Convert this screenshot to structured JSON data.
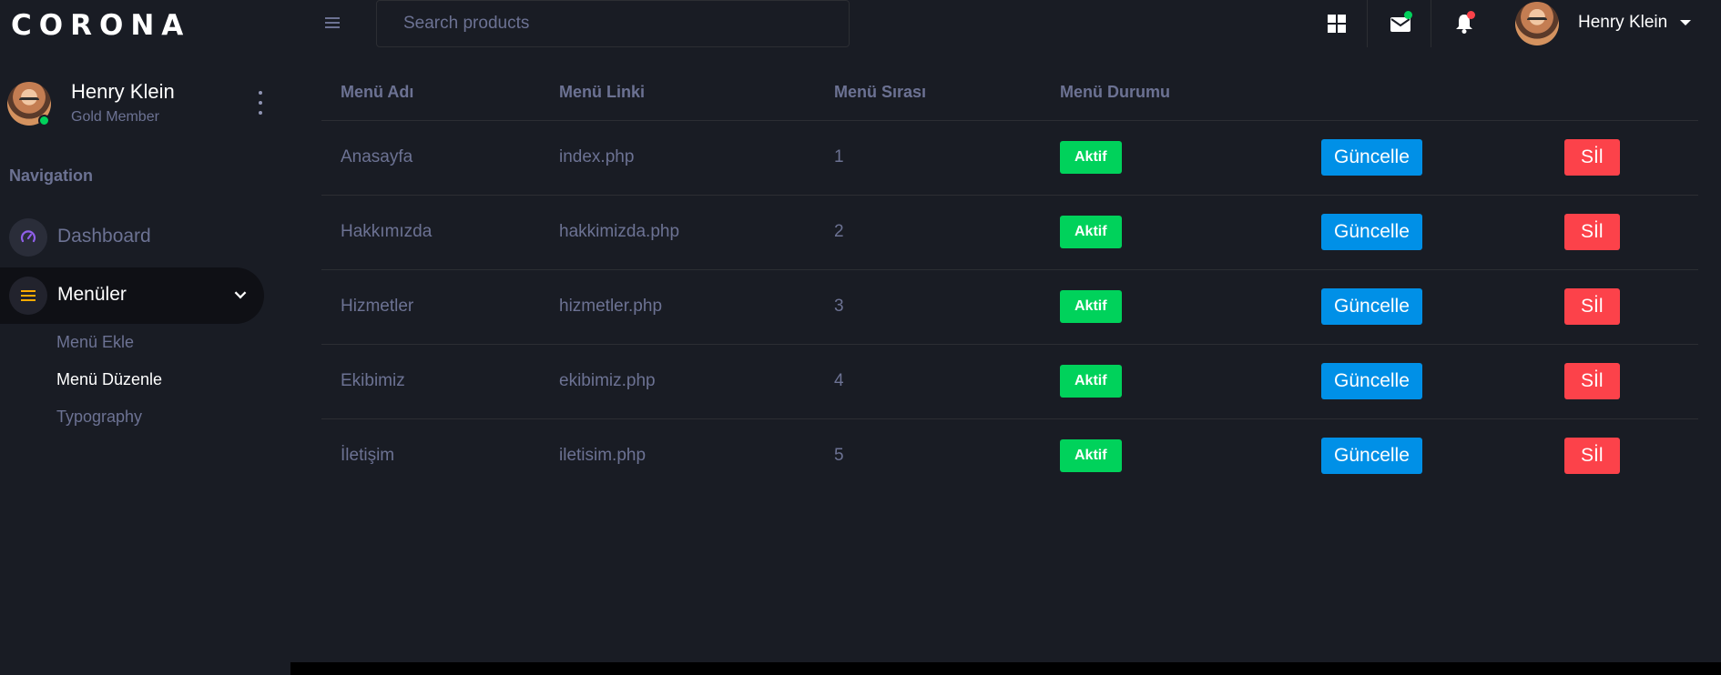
{
  "sidebar": {
    "brand": "CORONA",
    "profile": {
      "name": "Henry Klein",
      "role": "Gold Member"
    },
    "nav_heading": "Navigation",
    "items": [
      {
        "label": "Dashboard",
        "icon": "speedometer-icon"
      },
      {
        "label": "Menüler",
        "icon": "menu-lines-icon"
      }
    ],
    "subitems": [
      {
        "label": "Menü Ekle"
      },
      {
        "label": "Menü Düzenle"
      },
      {
        "label": "Typography"
      }
    ]
  },
  "topbar": {
    "search_placeholder": "Search products",
    "user_name": "Henry Klein"
  },
  "colors": {
    "background": "#191c24",
    "muted_text": "#6c7293",
    "success": "#00d25b",
    "primary": "#0090e7",
    "danger": "#fc424a"
  },
  "table": {
    "headers": [
      "Menü Adı",
      "Menü Linki",
      "Menü Sırası",
      "Menü Durumu"
    ],
    "update_label": "Güncelle",
    "delete_label": "Sİl",
    "rows": [
      {
        "name": "Anasayfa",
        "link": "index.php",
        "order": "1",
        "status": "Aktif"
      },
      {
        "name": "Hakkımızda",
        "link": "hakkimizda.php",
        "order": "2",
        "status": "Aktif"
      },
      {
        "name": "Hizmetler",
        "link": "hizmetler.php",
        "order": "3",
        "status": "Aktif"
      },
      {
        "name": "Ekibimiz",
        "link": "ekibimiz.php",
        "order": "4",
        "status": "Aktif"
      },
      {
        "name": "İletişim",
        "link": "iletisim.php",
        "order": "5",
        "status": "Aktif"
      }
    ]
  }
}
